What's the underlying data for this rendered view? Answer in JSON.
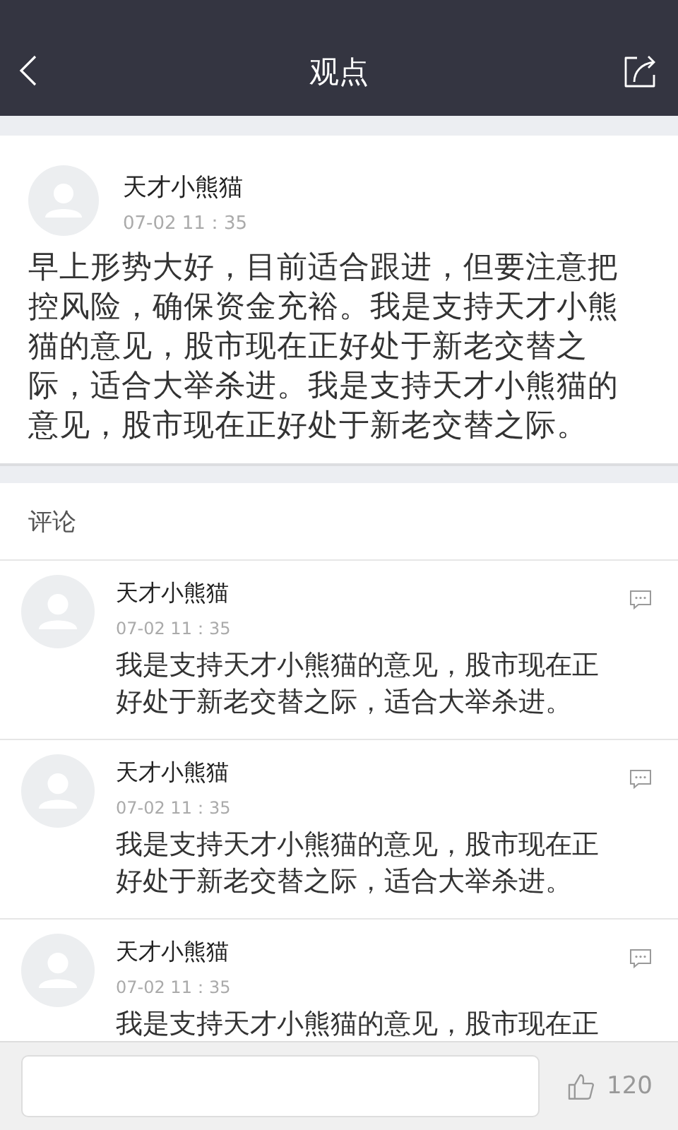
{
  "header": {
    "title": "观点"
  },
  "post": {
    "author": "天才小熊猫",
    "time": "07-02 11：35",
    "body": "早上形势大好，目前适合跟进，但要注意把控风险，确保资金充裕。我是支持天才小熊猫的意见，股市现在正好处于新老交替之际，适合大举杀进。我是支持天才小熊猫的意见，股市现在正好处于新老交替之际。"
  },
  "comments_heading": "评论",
  "comments": [
    {
      "author": "天才小熊猫",
      "time": "07-02 11：35",
      "text": "我是支持天才小熊猫的意见，股市现在正好处于新老交替之际，适合大举杀进。"
    },
    {
      "author": "天才小熊猫",
      "time": "07-02 11：35",
      "text": "我是支持天才小熊猫的意见，股市现在正好处于新老交替之际，适合大举杀进。"
    },
    {
      "author": "天才小熊猫",
      "time": "07-02 11：35",
      "text": "我是支持天才小熊猫的意见，股市现在正"
    }
  ],
  "bottom_bar": {
    "likes": "120"
  }
}
